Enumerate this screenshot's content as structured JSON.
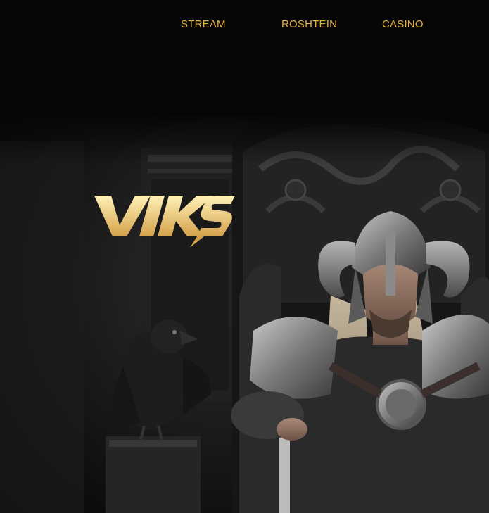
{
  "nav": {
    "links": [
      {
        "label": "STREAM"
      },
      {
        "label": "ROSHTEIN"
      },
      {
        "label": "CASINO"
      }
    ]
  },
  "brand": {
    "logo_text": "VIKS"
  },
  "colors": {
    "accent": "#E8B23A",
    "logo_light": "#FFF1B8",
    "logo_dark": "#D4A24A",
    "background": "#060606"
  },
  "hero": {
    "image": "viking-warrior-on-throne-with-raven"
  }
}
